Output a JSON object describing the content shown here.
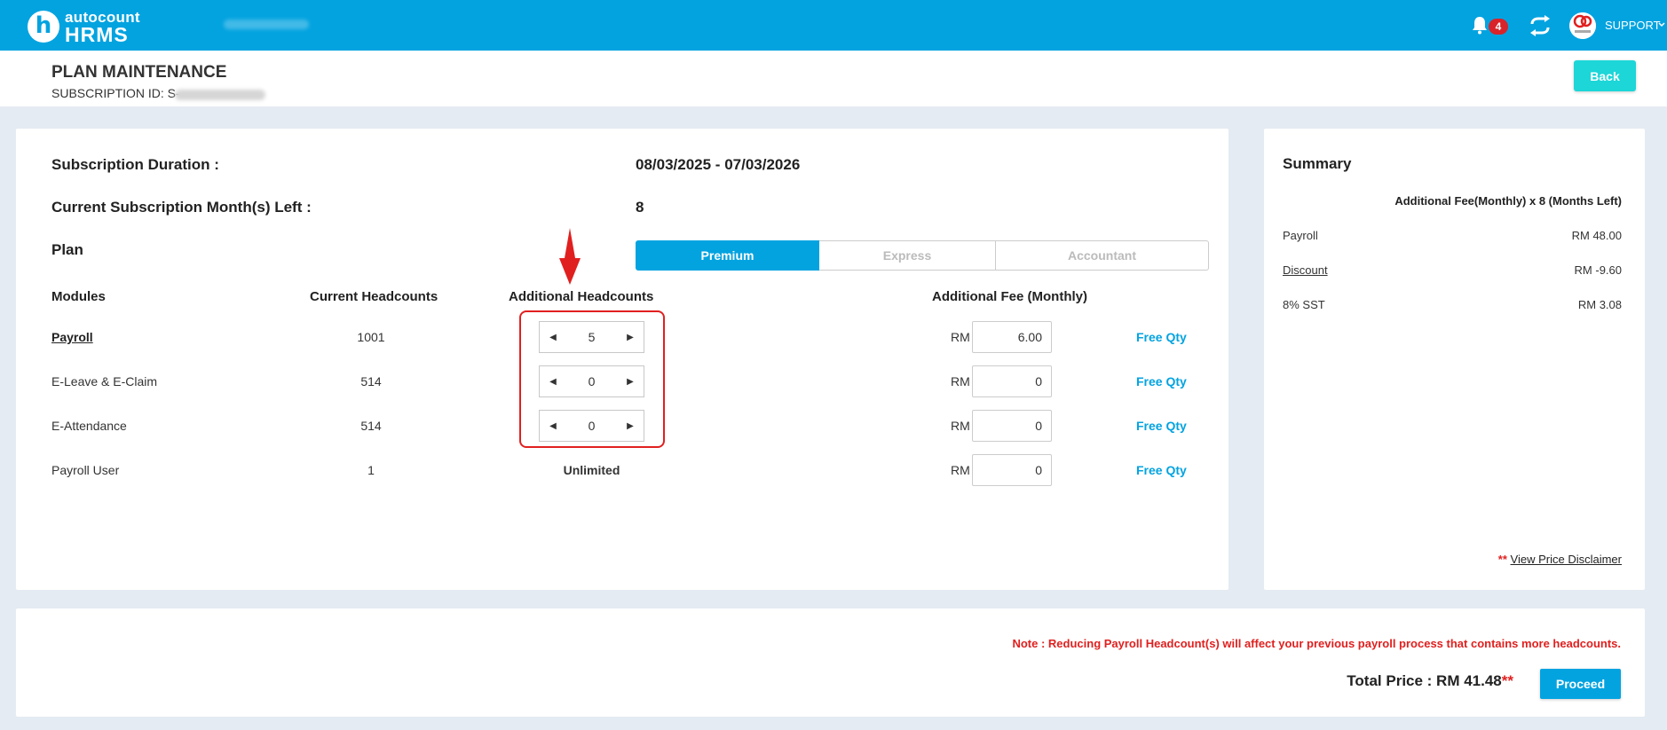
{
  "topbar": {
    "logo_top": "autocount",
    "logo_bottom": "HRMS",
    "notification_count": "4",
    "user_label": "SUPPORT"
  },
  "header": {
    "title": "PLAN MAINTENANCE",
    "subscription_id_label": "SUBSCRIPTION ID: S-",
    "back_label": "Back"
  },
  "subscription": {
    "duration_label": "Subscription Duration :",
    "duration_value": "08/03/2025 - 07/03/2026",
    "months_left_label": "Current Subscription Month(s) Left :",
    "months_left_value": "8",
    "plan_label": "Plan",
    "plans": [
      "Premium",
      "Express",
      "Accountant"
    ],
    "active_plan": "Premium"
  },
  "table": {
    "headers": {
      "modules": "Modules",
      "current": "Current Headcounts",
      "additional": "Additional Headcounts",
      "fee": "Additional Fee (Monthly)"
    },
    "currency": "RM",
    "free_qty_label": "Free Qty",
    "rows": [
      {
        "module": "Payroll",
        "current": "1001",
        "additional": "5",
        "fee": "6.00"
      },
      {
        "module": "E-Leave & E-Claim",
        "current": "514",
        "additional": "0",
        "fee": "0"
      },
      {
        "module": "E-Attendance",
        "current": "514",
        "additional": "0",
        "fee": "0"
      },
      {
        "module": "Payroll User",
        "current": "1",
        "additional": "Unlimited",
        "fee": "0"
      }
    ]
  },
  "summary": {
    "title": "Summary",
    "header": "Additional Fee(Monthly) x 8 (Months Left)",
    "rows": [
      {
        "label": "Payroll",
        "value": "RM 48.00"
      },
      {
        "label": "Discount",
        "value": "RM -9.60"
      },
      {
        "label": "8% SST",
        "value": "RM 3.08"
      }
    ],
    "disclaimer_stars": "**",
    "disclaimer_link": "View Price Disclaimer"
  },
  "footer": {
    "note": "Note : Reducing Payroll Headcount(s) will affect your previous payroll process that contains more headcounts.",
    "total_label": "Total Price : RM 41.48",
    "total_stars": "**",
    "proceed_label": "Proceed"
  },
  "colors": {
    "brand": "#03a3e0",
    "back_button": "#1cd6d8",
    "alert": "#e0201f"
  }
}
